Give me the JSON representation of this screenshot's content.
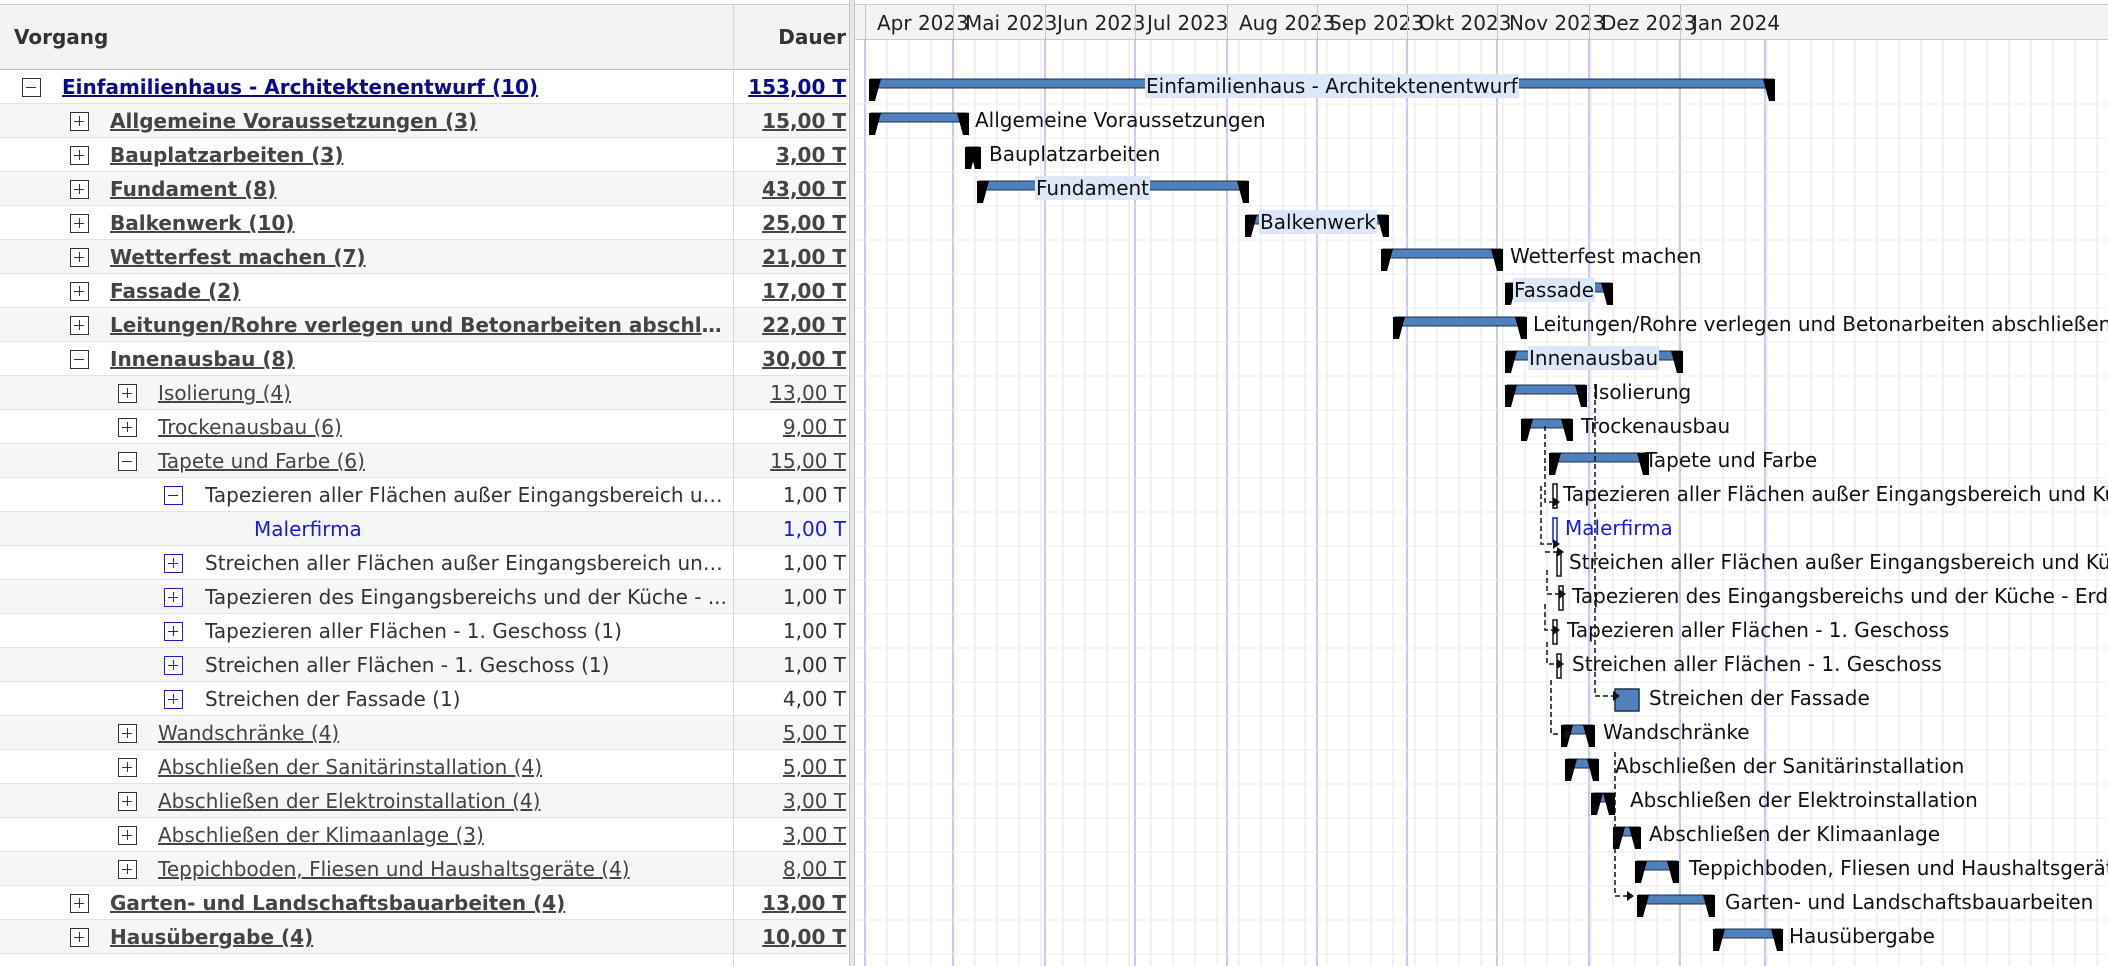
{
  "columns": {
    "task": "Vorgang",
    "duration": "Dauer"
  },
  "months": [
    "Apr 2023",
    "Mai 2023",
    "Jun 2023",
    "Jul 2023",
    "Aug 2023",
    "Sep 2023",
    "Okt 2023",
    "Nov 2023",
    "Dez 2023",
    "Jan 2024"
  ],
  "colors": {
    "bar": "#4f81bd",
    "bar_light": "#dce8f7",
    "summary_cap": "#000000",
    "resource": "#1a1ae0",
    "grid_line": "#e4e4e4",
    "month_line": "#c8c8f0"
  },
  "rows": [
    {
      "name": "Einfamilienhaus - Architektenentwurf (10)",
      "duration": "153,00 T",
      "level": 0,
      "toggle": "minus",
      "bar_label": "Einfamilienhaus - Architektenentwurf"
    },
    {
      "name": "Allgemeine Voraussetzungen (3)",
      "duration": "15,00 T",
      "level": 1,
      "toggle": "plus",
      "bar_label": "Allgemeine Voraussetzungen"
    },
    {
      "name": "Bauplatzarbeiten (3)",
      "duration": "3,00 T",
      "level": 1,
      "toggle": "plus",
      "bar_label": "Bauplatzarbeiten"
    },
    {
      "name": "Fundament (8)",
      "duration": "43,00 T",
      "level": 1,
      "toggle": "plus",
      "bar_label": "Fundament"
    },
    {
      "name": "Balkenwerk (10)",
      "duration": "25,00 T",
      "level": 1,
      "toggle": "plus",
      "bar_label": "Balkenwerk"
    },
    {
      "name": "Wetterfest machen (7)",
      "duration": "21,00 T",
      "level": 1,
      "toggle": "plus",
      "bar_label": "Wetterfest machen"
    },
    {
      "name": "Fassade (2)",
      "duration": "17,00 T",
      "level": 1,
      "toggle": "plus",
      "bar_label": "Fassade"
    },
    {
      "name": "Leitungen/Rohre verlegen und Betonarbeiten abschli...",
      "duration": "22,00 T",
      "level": 1,
      "toggle": "plus",
      "bar_label": "Leitungen/Rohre verlegen und Betonarbeiten abschließen"
    },
    {
      "name": "Innenausbau (8)",
      "duration": "30,00 T",
      "level": 1,
      "toggle": "minus",
      "bar_label": "Innenausbau"
    },
    {
      "name": "Isolierung (4)",
      "duration": "13,00 T",
      "level": 2,
      "toggle": "plus",
      "bar_label": "Isolierung"
    },
    {
      "name": "Trockenausbau (6)",
      "duration": "9,00 T",
      "level": 2,
      "toggle": "plus",
      "bar_label": "Trockenausbau"
    },
    {
      "name": "Tapete und Farbe (6)",
      "duration": "15,00 T",
      "level": 2,
      "toggle": "minus",
      "bar_label": "Tapete und Farbe"
    },
    {
      "name": "Tapezieren aller Flächen außer Eingangsbereich un...",
      "duration": "1,00 T",
      "level": 3,
      "toggle": "minus",
      "bar_label": "Tapezieren aller Flächen außer Eingangsbereich und Küche"
    },
    {
      "name": "Malerfirma",
      "duration": "1,00 T",
      "level": 4,
      "toggle": "",
      "bar_label": "Malerfirma"
    },
    {
      "name": "Streichen aller Flächen außer Eingangsbereich und ...",
      "duration": "1,00 T",
      "level": 3,
      "toggle": "plus",
      "bar_label": "Streichen aller Flächen außer Eingangsbereich und Küche"
    },
    {
      "name": "Tapezieren des Eingangsbereichs und der Küche - ...",
      "duration": "1,00 T",
      "level": 3,
      "toggle": "plus",
      "bar_label": "Tapezieren des Eingangsbereichs und der Küche - Erdgeschoss"
    },
    {
      "name": "Tapezieren aller Flächen - 1. Geschoss (1)",
      "duration": "1,00 T",
      "level": 3,
      "toggle": "plus",
      "bar_label": "Tapezieren aller Flächen - 1. Geschoss"
    },
    {
      "name": "Streichen aller Flächen - 1. Geschoss (1)",
      "duration": "1,00 T",
      "level": 3,
      "toggle": "plus",
      "bar_label": "Streichen aller Flächen - 1. Geschoss"
    },
    {
      "name": "Streichen der Fassade (1)",
      "duration": "4,00 T",
      "level": 3,
      "toggle": "plus",
      "bar_label": "Streichen der Fassade"
    },
    {
      "name": "Wandschränke (4)",
      "duration": "5,00 T",
      "level": 2,
      "toggle": "plus",
      "bar_label": "Wandschränke"
    },
    {
      "name": "Abschließen der Sanitärinstallation (4)",
      "duration": "5,00 T",
      "level": 2,
      "toggle": "plus",
      "bar_label": "Abschließen der Sanitärinstallation"
    },
    {
      "name": "Abschließen der Elektroinstallation (4)",
      "duration": "3,00 T",
      "level": 2,
      "toggle": "plus",
      "bar_label": "Abschließen der Elektroinstallation"
    },
    {
      "name": "Abschließen der Klimaanlage (3)",
      "duration": "3,00 T",
      "level": 2,
      "toggle": "plus",
      "bar_label": "Abschließen der Klimaanlage"
    },
    {
      "name": "Teppichboden, Fliesen und Haushaltsgeräte (4)",
      "duration": "8,00 T",
      "level": 2,
      "toggle": "plus",
      "bar_label": "Teppichboden, Fliesen und Haushaltsgeräte"
    },
    {
      "name": "Garten- und Landschaftsbauarbeiten (4)",
      "duration": "13,00 T",
      "level": 1,
      "toggle": "plus",
      "bar_label": "Garten- und Landschaftsbauarbeiten"
    },
    {
      "name": "Hausübergabe (4)",
      "duration": "10,00 T",
      "level": 1,
      "toggle": "plus",
      "bar_label": "Hausübergabe"
    }
  ]
}
